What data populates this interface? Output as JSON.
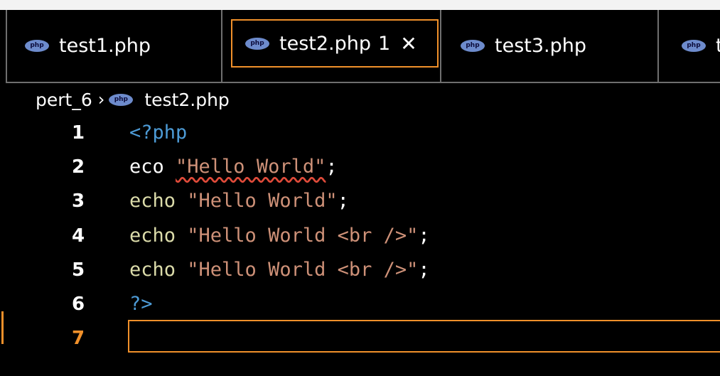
{
  "tabs": [
    {
      "label": "test1.php"
    },
    {
      "label": "test2.php",
      "badge": "1",
      "close": "✕"
    },
    {
      "label": "test3.php"
    },
    {
      "label": "t"
    }
  ],
  "breadcrumb": {
    "folder": "pert_6",
    "separator": "›",
    "file": "test2.php"
  },
  "editor": {
    "lines": [
      {
        "number": "1",
        "tokens": [
          {
            "text": "<?php",
            "kind": "tag"
          }
        ]
      },
      {
        "number": "2",
        "tokens": [
          {
            "text": "eco ",
            "kind": "plain"
          },
          {
            "text": "\"Hello World\"",
            "kind": "str-error"
          },
          {
            "text": ";",
            "kind": "semi"
          }
        ]
      },
      {
        "number": "3",
        "tokens": [
          {
            "text": "echo ",
            "kind": "echo"
          },
          {
            "text": "\"Hello World\"",
            "kind": "str"
          },
          {
            "text": ";",
            "kind": "semi"
          }
        ]
      },
      {
        "number": "4",
        "tokens": [
          {
            "text": "echo ",
            "kind": "echo"
          },
          {
            "text": "\"Hello World <br />\"",
            "kind": "str"
          },
          {
            "text": ";",
            "kind": "semi"
          }
        ]
      },
      {
        "number": "5",
        "tokens": [
          {
            "text": "echo ",
            "kind": "echo"
          },
          {
            "text": "\"Hello World <br />\"",
            "kind": "str"
          },
          {
            "text": ";",
            "kind": "semi"
          }
        ]
      },
      {
        "number": "6",
        "tokens": [
          {
            "text": "?>",
            "kind": "tag"
          }
        ]
      },
      {
        "number": "7",
        "tokens": []
      }
    ],
    "current_line": "7"
  },
  "colors": {
    "accent": "#f0902a",
    "tag": "#4d9bd6",
    "keyword": "#dcdcaa",
    "string": "#ce9178",
    "error": "#e04b3a"
  }
}
